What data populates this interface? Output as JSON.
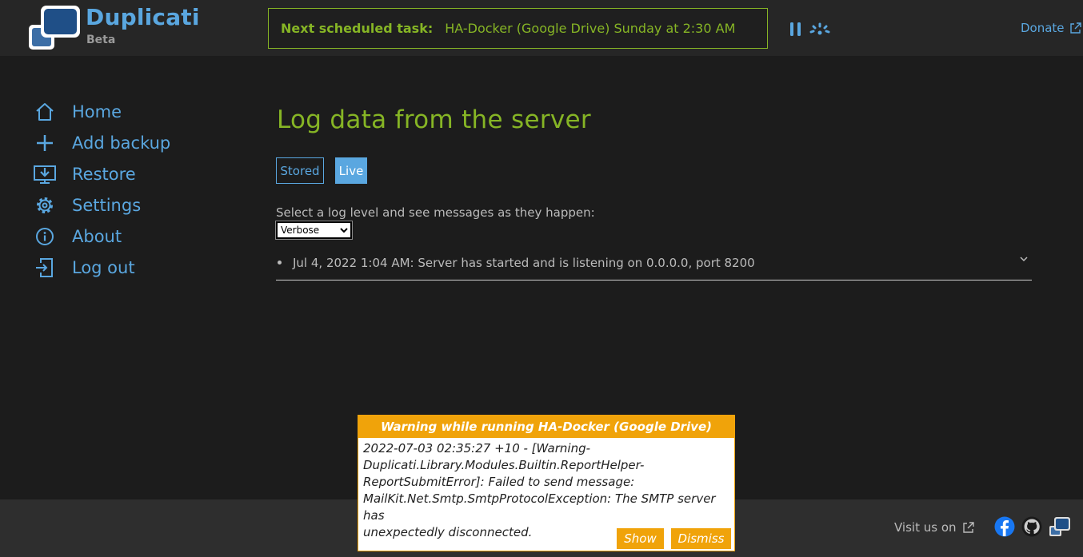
{
  "header": {
    "app_name": "Duplicati",
    "app_sub": "Beta",
    "task_label": "Next scheduled task:",
    "task_value": "HA-Docker (Google Drive) Sunday at 2:30 AM",
    "donate": "Donate"
  },
  "sidebar": {
    "items": [
      {
        "label": "Home",
        "icon": "home-icon"
      },
      {
        "label": "Add backup",
        "icon": "plus-icon"
      },
      {
        "label": "Restore",
        "icon": "restore-icon"
      },
      {
        "label": "Settings",
        "icon": "gear-icon"
      },
      {
        "label": "About",
        "icon": "info-icon"
      },
      {
        "label": "Log out",
        "icon": "logout-icon"
      }
    ]
  },
  "main": {
    "title": "Log data from the server",
    "tabs": [
      "Stored",
      "Live"
    ],
    "active_tab": "Live",
    "level_hint": "Select a log level and see messages as they happen:",
    "level_selected": "Verbose",
    "log_entries": [
      "Jul 4, 2022 1:04 AM: Server has started and is listening on 0.0.0.0, port 8200"
    ]
  },
  "footer": {
    "visit": "Visit us on"
  },
  "notification": {
    "title": "Warning while running HA-Docker (Google Drive)",
    "lines": [
      "2022-07-03 02:35:27 +10 - [Warning-",
      "Duplicati.Library.Modules.Builtin.ReportHelper-",
      "ReportSubmitError]: Failed to send message:",
      "MailKit.Net.Smtp.SmtpProtocolException: The SMTP server has",
      "unexpectedly disconnected."
    ],
    "show": "Show",
    "dismiss": "Dismiss"
  },
  "colors": {
    "accent_blue": "#5aa7e0",
    "accent_green": "#86b525",
    "warning_orange": "#f0a30a"
  }
}
